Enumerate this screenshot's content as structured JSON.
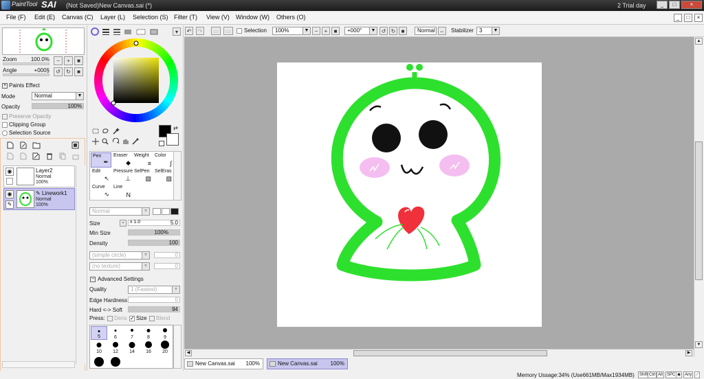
{
  "titlebar": {
    "app_name": "PaintTool",
    "app_name_big": "SAI",
    "document_title": "(Not Saved)New Canvas.sai (*)",
    "trial_text": "2 Trial day",
    "minimize_label": "_",
    "maximize_label": "□",
    "close_label": "×"
  },
  "menu": {
    "items": [
      "File (F)",
      "Edit (E)",
      "Canvas (C)",
      "Layer (L)",
      "Selection (S)",
      "Filter (T)",
      "View (V)",
      "Window (W)",
      "Others (O)"
    ],
    "mdi_minimize": "_",
    "mdi_restore": "□",
    "mdi_close": "×"
  },
  "navigator": {
    "zoom_label": "Zoom",
    "zoom_value": "100.0%",
    "angle_label": "Angle",
    "angle_value": "+000§"
  },
  "layer_panel": {
    "paints_effect_label": "Paints Effect",
    "mode_label": "Mode",
    "mode_value": "Normal",
    "opacity_label": "Opacity",
    "opacity_value": "100%",
    "opacity_level": 1.0,
    "preserve_opacity_label": "Preserve Opacity",
    "clipping_group_label": "Clipping Group",
    "selection_source_label": "Selection Source",
    "layers": [
      {
        "name": "Layer2",
        "mode": "Normal",
        "opacity": "100%",
        "selected": false
      },
      {
        "name": "Linework1",
        "mode": "Normal",
        "opacity": "100%",
        "selected": true
      }
    ]
  },
  "color": {
    "primary": "#000000",
    "secondary": "#ffffff",
    "hue_square_color": "#e8e000"
  },
  "tools": {
    "cells": [
      {
        "label": "Pen",
        "icon": "pen-icon",
        "glyph": "✒",
        "selected": true
      },
      {
        "label": "Eraser",
        "icon": "eraser-icon",
        "glyph": "◆",
        "selected": false
      },
      {
        "label": "Weight",
        "icon": "weight-icon",
        "glyph": "≡",
        "selected": false
      },
      {
        "label": "Color",
        "icon": "color-icon",
        "glyph": "∫",
        "selected": false
      },
      {
        "label": "Edit",
        "icon": "edit-icon",
        "glyph": "↖",
        "selected": false
      },
      {
        "label": "Pressure",
        "icon": "pressure-icon",
        "glyph": "⊥",
        "selected": false
      },
      {
        "label": "SelPen",
        "icon": "selpen-icon",
        "glyph": "▧",
        "selected": false
      },
      {
        "label": "SelEras",
        "icon": "seleras-icon",
        "glyph": "▨",
        "selected": false
      },
      {
        "label": "Curve",
        "icon": "curve-icon",
        "glyph": "∿",
        "selected": false
      },
      {
        "label": "Line",
        "icon": "line-icon",
        "glyph": "N",
        "selected": false
      }
    ],
    "blend_mode": "Normal",
    "size_label": "Size",
    "size_multiplier": "x 1.0",
    "size_value": "5.0",
    "min_size_label": "Min Size",
    "min_size_value": "100%",
    "min_size_level": 1.0,
    "density_label": "Density",
    "density_value": "100",
    "density_level": 1.0,
    "shape_combo": "(simple circle)",
    "shape_value": "0",
    "texture_combo": "(no texture)",
    "texture_value": "0",
    "advanced_label": "Advanced Settings",
    "quality_label": "Quality",
    "quality_value": "1 (Fastest)",
    "edge_hardness_label": "Edge Hardness",
    "edge_hardness_value": "0",
    "hard_soft_label": "Hard <-> Soft",
    "hard_soft_value": "94",
    "hard_soft_level": 0.94,
    "press_label": "Press:",
    "press_dens_label": "Dens",
    "press_size_label": "Size",
    "press_blend_label": "Blend",
    "brush_sizes": [
      "5",
      "6",
      "7",
      "8",
      "9",
      "10",
      "12",
      "14",
      "16",
      "20"
    ]
  },
  "canvas_toolbar": {
    "selection_label": "Selection",
    "zoom_value": "100%",
    "angle_value": "+000°",
    "mode_value": "Normal",
    "stabilizer_label": "Stabilizer",
    "stabilizer_value": "3"
  },
  "tabs": [
    {
      "name": "New Canvas.sai",
      "zoom": "100%",
      "selected": false
    },
    {
      "name": "New Canvas.sai",
      "zoom": "100%",
      "selected": true
    }
  ],
  "status": {
    "memory": "Memory Ussage:34% (Use661MB/Max1934MB)",
    "keys": [
      "Shift",
      "Ctrl",
      "Alt",
      "SPC",
      "◉",
      "Any",
      "⟋"
    ]
  }
}
